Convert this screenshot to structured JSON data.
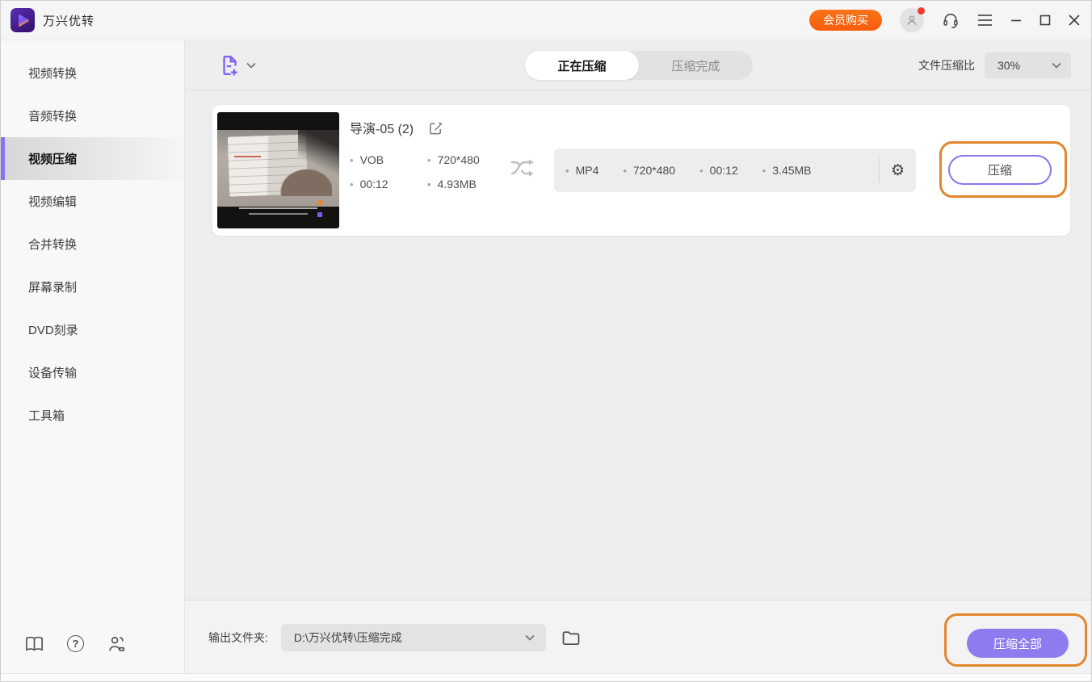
{
  "window": {
    "title": "万兴优转"
  },
  "titlebar": {
    "vip_button_label": "会员购买"
  },
  "sidebar": {
    "items": [
      "视频转换",
      "音频转换",
      "视频压缩",
      "视频编辑",
      "合并转换",
      "屏幕录制",
      "DVD刻录",
      "设备传输",
      "工具箱"
    ],
    "active_item": "视频压缩"
  },
  "toolbar": {
    "tabs": [
      {
        "label": "正在压缩",
        "active": true
      },
      {
        "label": "压缩完成",
        "active": false
      }
    ],
    "compression_ratio_label": "文件压缩比",
    "compression_ratio_value": "30%"
  },
  "file_card": {
    "title": "导演-05 (2)",
    "source": {
      "format": "VOB",
      "resolution": "720*480",
      "duration": "00:12",
      "size": "4.93MB"
    },
    "output": {
      "format": "MP4",
      "resolution": "720*480",
      "duration": "00:12",
      "size": "3.45MB"
    },
    "compress_button_label": "压缩"
  },
  "footer": {
    "output_folder_label": "输出文件夹:",
    "output_folder_path": "D:\\万兴优转\\压缩完成",
    "compress_all_button_label": "压缩全部"
  },
  "icons": {
    "gear_glyph": "⚙",
    "question_glyph": "?",
    "bullet_glyph": "•"
  },
  "colors": {
    "accent_purple": "#8a76f0",
    "accent_orange": "#fa6412",
    "annotation_orange": "#e2862d",
    "active_tab_text": "#161616",
    "notification_red": "#f4382b"
  }
}
